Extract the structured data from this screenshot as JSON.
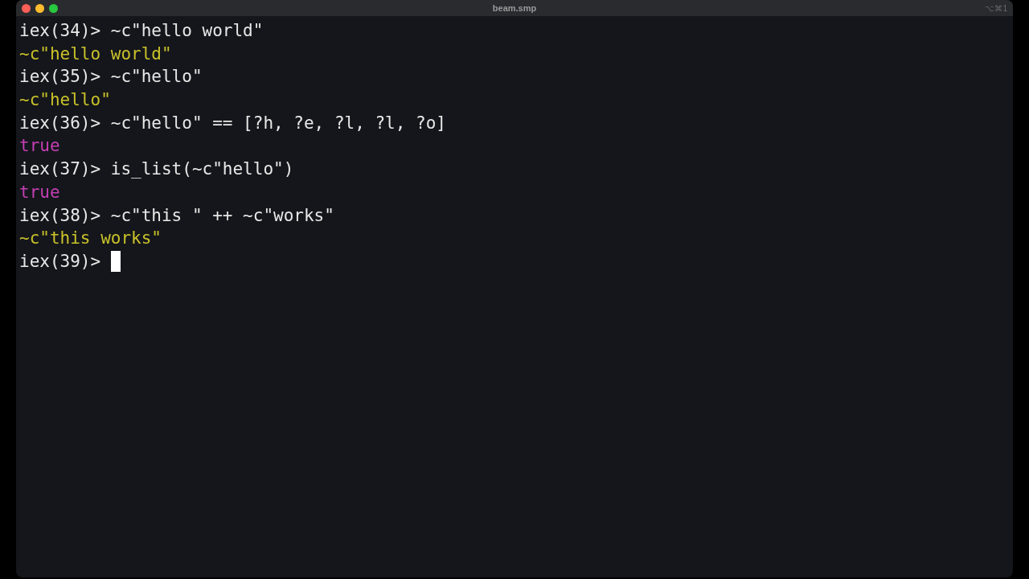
{
  "window": {
    "title": "beam.smp",
    "shortcut": "⌥⌘1"
  },
  "lines": [
    {
      "kind": "input",
      "prompt": "iex(34)>",
      "code": "~c\"hello world\""
    },
    {
      "kind": "string",
      "text": "~c\"hello world\""
    },
    {
      "kind": "input",
      "prompt": "iex(35)>",
      "code": "~c\"hello\""
    },
    {
      "kind": "string",
      "text": "~c\"hello\""
    },
    {
      "kind": "input",
      "prompt": "iex(36)>",
      "code": "~c\"hello\" == [?h, ?e, ?l, ?l, ?o]"
    },
    {
      "kind": "atom",
      "text": "true"
    },
    {
      "kind": "input",
      "prompt": "iex(37)>",
      "code": "is_list(~c\"hello\")"
    },
    {
      "kind": "atom",
      "text": "true"
    },
    {
      "kind": "input",
      "prompt": "iex(38)>",
      "code": "~c\"this \" ++ ~c\"works\""
    },
    {
      "kind": "string",
      "text": "~c\"this works\""
    },
    {
      "kind": "input",
      "prompt": "iex(39)>",
      "cursor": true
    }
  ]
}
